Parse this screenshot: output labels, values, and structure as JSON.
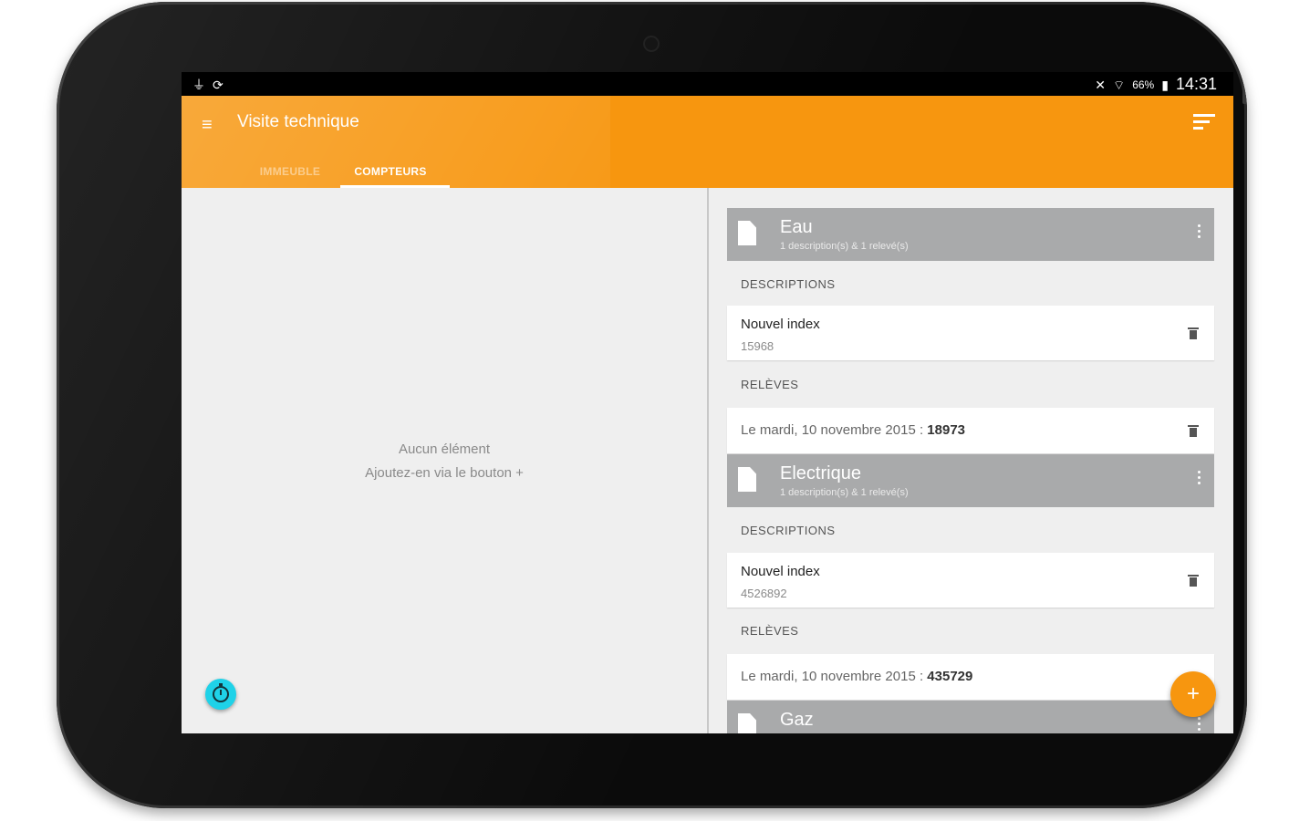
{
  "status_bar": {
    "left_icons": [
      "usb-icon",
      "sync-icon"
    ],
    "mute_icon": "vibrate-mute-icon",
    "wifi_icon": "wifi-icon",
    "battery_percent": "66%",
    "battery_icon": "battery-charging-icon",
    "time": "14:31"
  },
  "app_bar": {
    "menu_icon": "hamburger-menu-icon",
    "title": "Visite technique",
    "sort_icon": "sort-icon",
    "tabs": [
      {
        "label": "IMMEUBLE",
        "active": false
      },
      {
        "label": "COMPTEURS",
        "active": true
      }
    ]
  },
  "left_pane": {
    "empty_line1": "Aucun élément",
    "empty_line2": "Ajoutez-en via le bouton +",
    "fab_icon": "timer-icon"
  },
  "right_pane": {
    "categories": [
      {
        "name": "Eau",
        "subtitle": "1 description(s) & 1 relevé(s)",
        "descriptions_label": "DESCRIPTIONS",
        "description": {
          "title": "Nouvel index",
          "value": "15968"
        },
        "releves_label": "RELÈVES",
        "releve": {
          "date": "Le mardi, 10 novembre 2015 : ",
          "value": "18973"
        }
      },
      {
        "name": "Electrique",
        "subtitle": "1 description(s) & 1 relevé(s)",
        "descriptions_label": "DESCRIPTIONS",
        "description": {
          "title": "Nouvel index",
          "value": "4526892"
        },
        "releves_label": "RELÈVES",
        "releve": {
          "date": "Le mardi, 10 novembre 2015 : ",
          "value": "435729"
        }
      },
      {
        "name": "Gaz"
      }
    ],
    "fab_label": "+"
  },
  "colors": {
    "primary": "#f7960f",
    "category_header": "#a9aaab",
    "accent_cyan": "#1fd2e8",
    "background": "#efefef"
  }
}
